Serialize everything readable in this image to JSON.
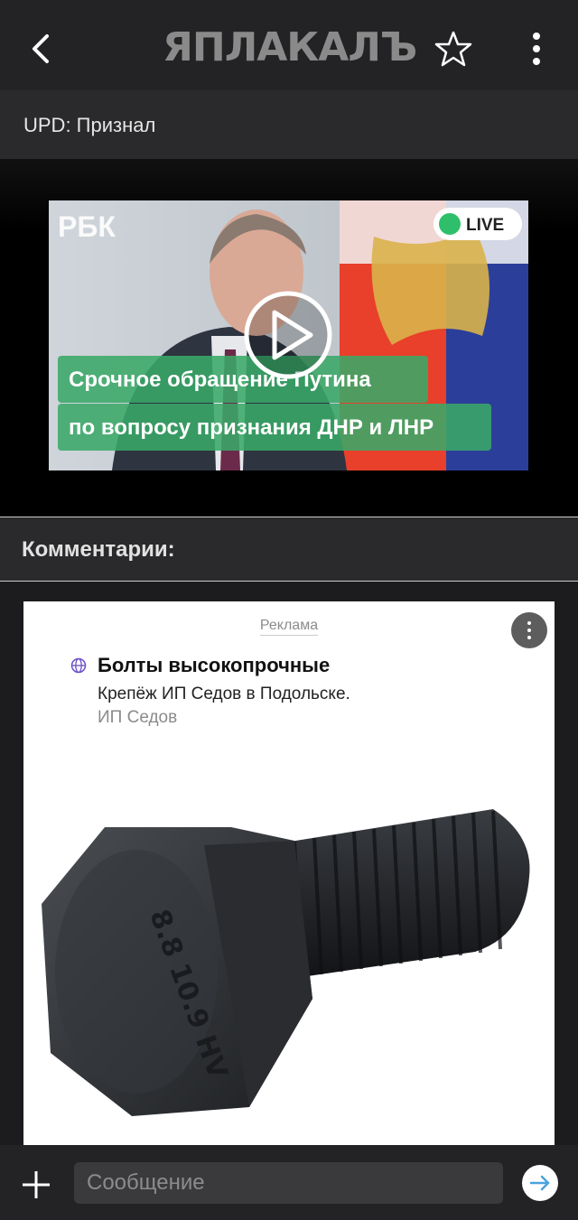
{
  "header": {
    "logo": "ЯПЛАКАЛЪ"
  },
  "post": {
    "title": "UPD: Признал"
  },
  "video": {
    "channel": "РБК",
    "live_label": "LIVE",
    "caption_line1": "Срочное обращение Путина",
    "caption_line2": "по вопросу признания ДНР и ЛНР"
  },
  "comments": {
    "title": "Комментарии:"
  },
  "ad": {
    "label": "Реклама",
    "headline": "Болты высокопрочные",
    "description": "Крепёж ИП Седов в Подольске.",
    "source": "ИП Седов",
    "bolt_marking": "8.8 10.9 HV"
  },
  "composer": {
    "placeholder": "Сообщение"
  },
  "colors": {
    "accent": "#4aa3df",
    "live_green": "#2fbf6b",
    "caption_bg": "#3aa868"
  }
}
